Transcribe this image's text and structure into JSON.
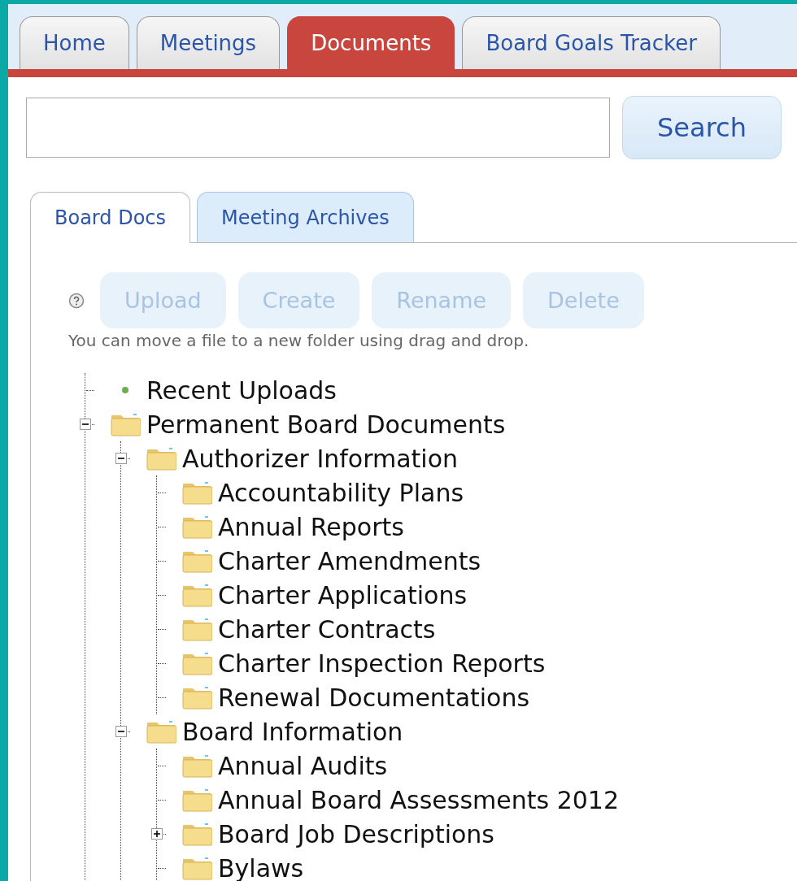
{
  "main_tabs": [
    {
      "label": "Home",
      "selected": false
    },
    {
      "label": "Meetings",
      "selected": false
    },
    {
      "label": "Documents",
      "selected": true
    },
    {
      "label": "Board Goals Tracker",
      "selected": false
    }
  ],
  "search": {
    "button": "Search"
  },
  "doc_tabs": [
    {
      "label": "Board Docs",
      "selected": true
    },
    {
      "label": "Meeting Archives",
      "selected": false
    }
  ],
  "toolbar": {
    "buttons": [
      {
        "label": "Upload",
        "disabled": true
      },
      {
        "label": "Create",
        "disabled": true
      },
      {
        "label": "Rename",
        "disabled": true
      },
      {
        "label": "Delete",
        "disabled": true
      }
    ],
    "hint": "You can move a file to a new folder using drag and drop."
  },
  "tree": [
    {
      "kind": "recent",
      "label": "Recent Uploads"
    },
    {
      "kind": "folder",
      "label": "Permanent Board Documents",
      "expanded": true,
      "children": [
        {
          "kind": "folder",
          "label": "Authorizer Information",
          "expanded": true,
          "children": [
            {
              "kind": "folder",
              "label": "Accountability Plans"
            },
            {
              "kind": "folder",
              "label": "Annual Reports"
            },
            {
              "kind": "folder",
              "label": "Charter Amendments"
            },
            {
              "kind": "folder",
              "label": "Charter Applications"
            },
            {
              "kind": "folder",
              "label": "Charter Contracts"
            },
            {
              "kind": "folder",
              "label": "Charter Inspection Reports"
            },
            {
              "kind": "folder",
              "label": "Renewal Documentations"
            }
          ]
        },
        {
          "kind": "folder",
          "label": "Board Information",
          "expanded": true,
          "children": [
            {
              "kind": "folder",
              "label": "Annual Audits"
            },
            {
              "kind": "folder",
              "label": "Annual Board Assessments 2012"
            },
            {
              "kind": "folder",
              "label": "Board Job Descriptions",
              "expanded": false
            },
            {
              "kind": "folder",
              "label": "Bylaws"
            }
          ]
        }
      ]
    }
  ]
}
